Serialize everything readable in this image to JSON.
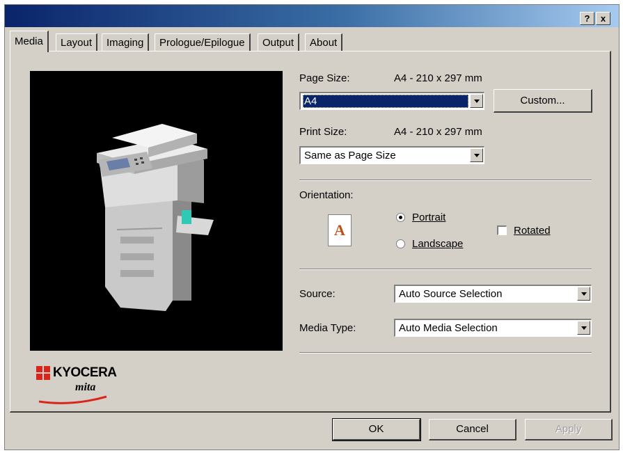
{
  "titlebar": {
    "help_label": "?",
    "close_label": "x"
  },
  "tabs": [
    {
      "label": "Media",
      "active": true
    },
    {
      "label": "Layout"
    },
    {
      "label": "Imaging"
    },
    {
      "label": "Prologue/Epilogue"
    },
    {
      "label": "Output"
    },
    {
      "label": "About"
    }
  ],
  "page_size": {
    "label": "Page Size:",
    "value_text": "A4 - 210 x 297 mm",
    "selected": "A4"
  },
  "custom_button": "Custom...",
  "print_size": {
    "label": "Print Size:",
    "value_text": "A4 - 210 x 297 mm",
    "selected": "Same as Page Size"
  },
  "orientation": {
    "label": "Orientation:",
    "preview_letter": "A",
    "portrait": "Portrait",
    "landscape": "Landscape",
    "rotated": "Rotated",
    "selected": "portrait",
    "rotated_checked": false
  },
  "source": {
    "label": "Source:",
    "selected": "Auto Source Selection"
  },
  "media_type": {
    "label": "Media Type:",
    "selected": "Auto Media Selection"
  },
  "logo": {
    "brand": "KYOCERA",
    "sub": "mita"
  },
  "buttons": {
    "ok": "OK",
    "cancel": "Cancel",
    "apply": "Apply"
  },
  "colors": {
    "accent": "#0a246a",
    "logo_red": "#d9261c",
    "face": "#d4d0c8"
  }
}
